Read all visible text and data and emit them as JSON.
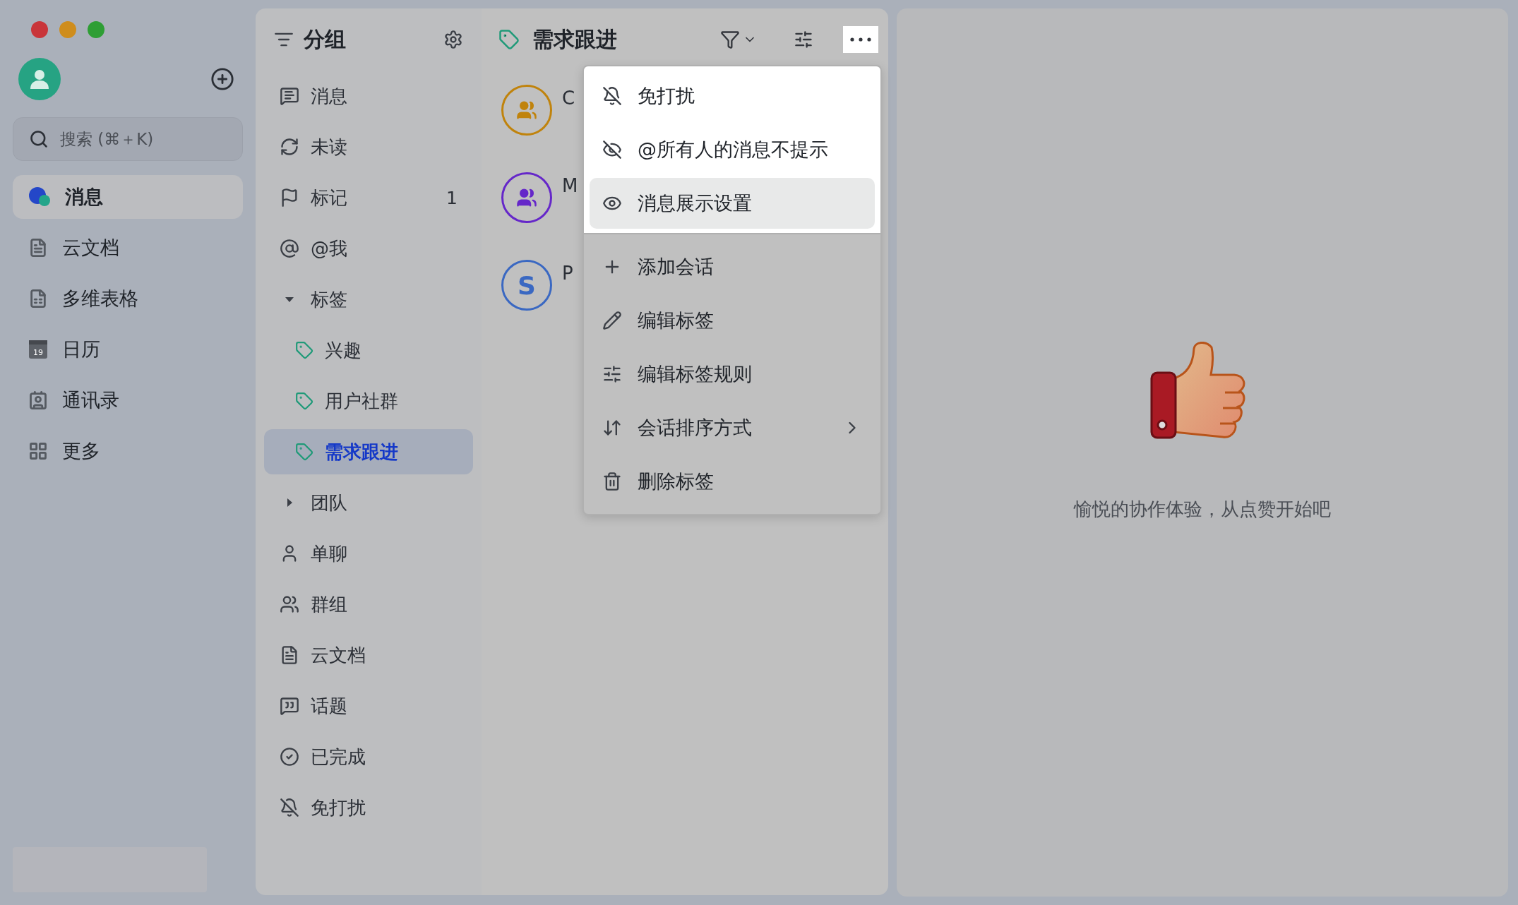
{
  "window": {
    "controls": [
      {
        "color": "#c9353a"
      },
      {
        "color": "#cf8d1c"
      },
      {
        "color": "#2e9e34"
      }
    ]
  },
  "sidebar": {
    "search": {
      "placeholder": "搜索 (⌘＋K)"
    },
    "items": [
      {
        "label": "消息",
        "selected": true
      },
      {
        "label": "云文档",
        "selected": false
      },
      {
        "label": "多维表格",
        "selected": false
      },
      {
        "label": "日历",
        "selected": false,
        "icon_text": "19"
      },
      {
        "label": "通讯录",
        "selected": false
      },
      {
        "label": "更多",
        "selected": false
      }
    ]
  },
  "groups": {
    "title": "分组",
    "items": [
      {
        "label": "消息",
        "selected": false
      },
      {
        "label": "未读",
        "selected": false
      },
      {
        "label": "标记",
        "selected": false,
        "count": "1"
      },
      {
        "label": "@我",
        "selected": false
      },
      {
        "label": "标签",
        "selected": false,
        "expanded": true,
        "children": [
          {
            "label": "兴趣",
            "selected": false
          },
          {
            "label": "用户社群",
            "selected": false
          },
          {
            "label": "需求跟进",
            "selected": true
          }
        ]
      },
      {
        "label": "团队",
        "selected": false,
        "expanded": false
      },
      {
        "label": "单聊",
        "selected": false
      },
      {
        "label": "群组",
        "selected": false
      },
      {
        "label": "云文档",
        "selected": false
      },
      {
        "label": "话题",
        "selected": false
      },
      {
        "label": "已完成",
        "selected": false
      },
      {
        "label": "免打扰",
        "selected": false
      }
    ]
  },
  "conversations": {
    "title": "需求跟进",
    "items": [
      {
        "kind": "group",
        "name": "C",
        "color": "#c0830c"
      },
      {
        "kind": "group",
        "name": "M",
        "color": "#6527c9"
      },
      {
        "kind": "letter",
        "initial": "S",
        "name": "P",
        "color": "#3a68c2"
      }
    ]
  },
  "menu": {
    "sections": [
      {
        "kind": "highlighted",
        "items": [
          {
            "label": "免打扰",
            "selected": false
          },
          {
            "label": "@所有人的消息不提示",
            "selected": false
          },
          {
            "label": "消息展示设置",
            "selected": true
          }
        ]
      },
      {
        "kind": "plain",
        "items": [
          {
            "label": "添加会话",
            "selected": false
          },
          {
            "label": "编辑标签",
            "selected": false
          },
          {
            "label": "编辑标签规则",
            "selected": false
          },
          {
            "label": "会话排序方式",
            "selected": false,
            "submenu": true
          },
          {
            "label": "删除标签",
            "selected": false
          }
        ]
      }
    ]
  },
  "empty_state": {
    "text": "愉悦的协作体验，从点赞开始吧"
  }
}
